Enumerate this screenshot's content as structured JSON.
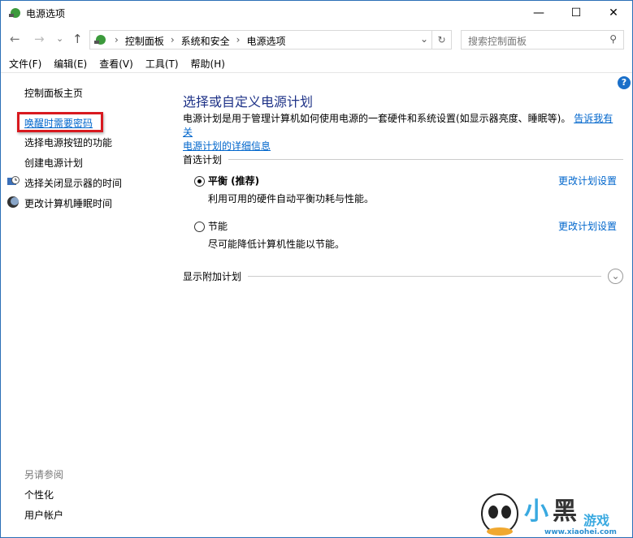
{
  "window": {
    "title": "电源选项",
    "minimize": "—",
    "maximize": "☐",
    "close": "✕"
  },
  "nav": {
    "back": "←",
    "forward": "→",
    "recent": "⌄",
    "up": "↑"
  },
  "address": {
    "crumbs": [
      "控制面板",
      "系统和安全",
      "电源选项"
    ],
    "separator": "›",
    "dropdown": "⌄",
    "refresh": "↻"
  },
  "search": {
    "placeholder": "搜索控制面板",
    "icon": "⚲"
  },
  "menu": [
    "文件(F)",
    "编辑(E)",
    "查看(V)",
    "工具(T)",
    "帮助(H)"
  ],
  "help": "?",
  "sidebar": {
    "home": "控制面板主页",
    "links": [
      "唤醒时需要密码",
      "选择电源按钮的功能",
      "创建电源计划",
      "选择关闭显示器的时间",
      "更改计算机睡眠时间"
    ],
    "see_also": "另请参阅",
    "see_also_links": [
      "个性化",
      "用户帐户"
    ]
  },
  "main": {
    "title": "选择或自定义电源计划",
    "desc": "电源计划是用于管理计算机如何使用电源的一套硬件和系统设置(如显示器亮度、睡眠等)。",
    "desc_link1": "告诉我有关",
    "desc_link2": "电源计划的详细信息",
    "preferred": "首选计划",
    "plans": [
      {
        "name": "平衡 (推荐)",
        "desc": "利用可用的硬件自动平衡功耗与性能。",
        "action": "更改计划设置",
        "selected": true
      },
      {
        "name": "节能",
        "desc": "尽可能降低计算机性能以节能。",
        "action": "更改计划设置",
        "selected": false
      }
    ],
    "more": "显示附加计划",
    "more_icon": "⌄"
  },
  "watermark": {
    "text": "小黑游戏",
    "url": "www.xiaohei.com"
  }
}
